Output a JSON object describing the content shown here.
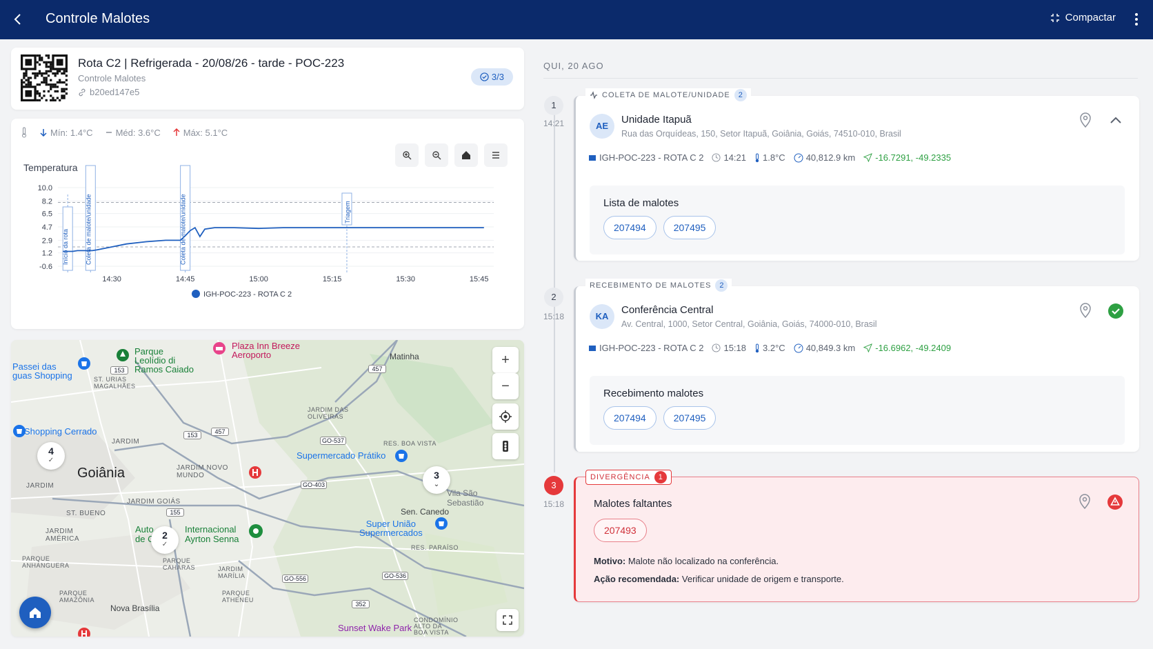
{
  "topbar": {
    "title": "Controle Malotes",
    "compact_label": "Compactar"
  },
  "header": {
    "route": "Rota C2 | Refrigerada - 20/08/26 - tarde - POC-223",
    "subtitle": "Controle Malotes",
    "hash": "b20ed147e5",
    "progress": "3/3"
  },
  "temp_stats": {
    "min": "Mín: 1.4°C",
    "avg": "Méd: 3.6°C",
    "max": "Máx: 5.1°C"
  },
  "chart_data": {
    "type": "line",
    "title": "Temperatura",
    "x_ticks": [
      "14:30",
      "14:45",
      "15:00",
      "15:15",
      "15:30",
      "15:45"
    ],
    "y_ticks": [
      "10.0",
      "8.2",
      "6.5",
      "4.7",
      "2.9",
      "1.2",
      "-0.6"
    ],
    "ylim": [
      -0.6,
      10.0
    ],
    "xlim_minutes": [
      "14:19",
      "15:48"
    ],
    "thresholds": [
      2.0,
      8.0
    ],
    "series": [
      {
        "name": "IGH-POC-223 - ROTA C 2",
        "color": "#1f5fbf",
        "points": [
          [
            "14:20",
            1.4
          ],
          [
            "14:22",
            1.4
          ],
          [
            "14:23",
            1.5
          ],
          [
            "14:26",
            1.5
          ],
          [
            "14:27",
            1.6
          ],
          [
            "14:30",
            2.0
          ],
          [
            "14:33",
            2.4
          ],
          [
            "14:37",
            2.7
          ],
          [
            "14:41",
            2.9
          ],
          [
            "14:44",
            2.9
          ],
          [
            "14:45",
            3.5
          ],
          [
            "14:46",
            4.2
          ],
          [
            "14:47",
            4.6
          ],
          [
            "14:48",
            3.4
          ],
          [
            "14:49",
            4.4
          ],
          [
            "14:51",
            4.6
          ],
          [
            "14:55",
            4.6
          ],
          [
            "15:00",
            4.5
          ],
          [
            "15:05",
            4.6
          ],
          [
            "15:10",
            4.6
          ],
          [
            "15:15",
            4.6
          ],
          [
            "15:30",
            4.6
          ],
          [
            "15:46",
            4.6
          ]
        ]
      }
    ],
    "annotations": [
      {
        "label": "Início da rota",
        "x": "14:21"
      },
      {
        "label": "Coleta de malote/unidade",
        "x": "14:22"
      },
      {
        "label": "Coleta de malote/unidade",
        "x": "14:45"
      },
      {
        "label": "Triagem",
        "x": "15:18"
      }
    ]
  },
  "map": {
    "labels": {
      "matinha": "Matinha",
      "goiania": "Goiânia",
      "sen_canedo": "Sen. Canedo",
      "nova_brasilia": "Nova Brasília",
      "jardim": "JARDIM",
      "jardim2": "JARDIM",
      "jardim_novo_mundo": "JARDIM NOVO\nMUNDO",
      "jardim_goias": "JARDIM GOIÁS",
      "st_bueno": "ST. BUENO",
      "jardim_america": "JARDIM\nAMÉRICA",
      "parque_anhanguera": "PARQUE\nANHANGUERA",
      "parque_amazonia": "PARQUE\nAMAZÔNIA",
      "st_urias": "ST. URIAS\nMAGALHÃES",
      "jardim_oliveiras": "JARDIM DAS\nOLIVEIRAS",
      "res_boa_vista": "RES. BOA VISTA",
      "res_paraiso": "RES. PARAÍSO",
      "jardim_marilia": "JARDIM\nMARÍLIA",
      "parque_atheneu": "PARQUE\nATHENEU",
      "condominio": "CONDOMÍNIO\nALTO DA\nBOA VISTA",
      "parque_caje": "PARQUE\nCAHARAS",
      "vila_sao": "Vila São\nSebastião",
      "passeio": "Passei das\nguas Shopping",
      "parque_leolidio": "Parque\nLeolídio di\nRamos Caiado",
      "plaza_inn": "Plaza Inn Breeze\nAeroporto",
      "shopping_cerrado": "Shopping Cerrado",
      "supermercado_pratiko": "Supermercado Prátiko",
      "super_uniao": "Super União\nSupermercados",
      "internacional": "Internacional\nAyrton Senna",
      "auto": "Auto\nde C",
      "sunset": "Sunset Wake Park"
    },
    "roads": [
      "153",
      "457",
      "153",
      "457",
      "GO-537",
      "GO-403",
      "155",
      "GO-556",
      "GO-536",
      "352"
    ],
    "clusters": [
      {
        "count": "4"
      },
      {
        "count": "2"
      },
      {
        "count": "3"
      }
    ]
  },
  "timeline": {
    "day": "QUI, 20 AGO",
    "events": [
      {
        "step": "1",
        "time": "14:21",
        "tag": "COLETA DE MALOTE/UNIDADE",
        "tag_count": "2",
        "avatar": "AE",
        "name": "Unidade Itapuã",
        "address": "Rua das Orquídeas, 150, Setor Itapuã, Goiânia, Goiás, 74510-010, Brasil",
        "vehicle": "IGH-POC-223 - ROTA C 2",
        "clock": "14:21",
        "temp": "1.8°C",
        "km": "40,812.9 km",
        "coords": "-16.7291, -49.2335",
        "list_title": "Lista de malotes",
        "chips": [
          "207494",
          "207495"
        ]
      },
      {
        "step": "2",
        "time": "15:18",
        "tag": "RECEBIMENTO DE MALOTES",
        "tag_count": "2",
        "avatar": "KA",
        "name": "Conferência Central",
        "address": "Av. Central, 1000, Setor Central, Goiânia, Goiás, 74000-010, Brasil",
        "vehicle": "IGH-POC-223 - ROTA C 2",
        "clock": "15:18",
        "temp": "3.2°C",
        "km": "40,849.3 km",
        "coords": "-16.6962, -49.2409",
        "list_title": "Recebimento malotes",
        "chips": [
          "207494",
          "207495"
        ]
      },
      {
        "step": "3",
        "time": "15:18",
        "tag": "DIVERGÊNCIA",
        "tag_count": "1",
        "title": "Malotes faltantes",
        "chips": [
          "207493"
        ],
        "motivo_label": "Motivo:",
        "motivo": "Malote não localizado na conferência.",
        "acao_label": "Ação recomendada:",
        "acao": "Verificar unidade de origem e transporte."
      }
    ]
  },
  "colors": {
    "navy": "#0b2a6b",
    "accent": "#1f5fbf",
    "success": "#2ea043",
    "danger": "#e5393b"
  }
}
